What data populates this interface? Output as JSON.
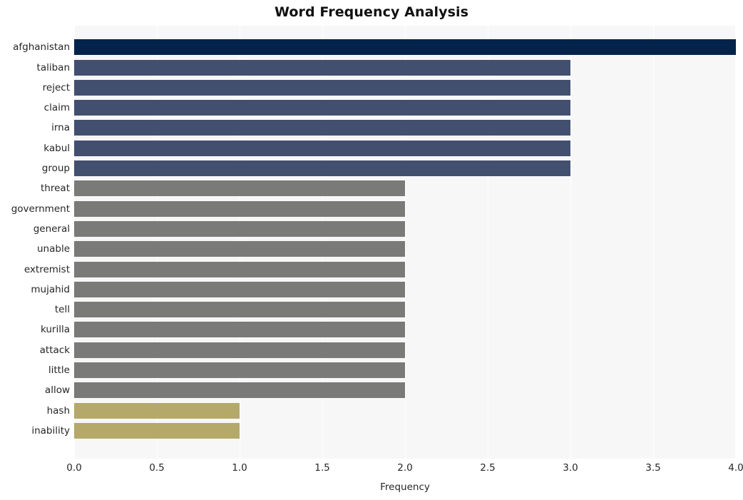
{
  "chart_data": {
    "type": "bar",
    "orientation": "horizontal",
    "title": "Word Frequency Analysis",
    "xlabel": "Frequency",
    "ylabel": "",
    "xlim": [
      0,
      4
    ],
    "ylim": null,
    "grid": true,
    "legend": null,
    "xticks": [
      "0.0",
      "0.5",
      "1.0",
      "1.5",
      "2.0",
      "2.5",
      "3.0",
      "3.5",
      "4.0"
    ],
    "xtick_values": [
      0,
      0.5,
      1,
      1.5,
      2,
      2.5,
      3,
      3.5,
      4
    ],
    "categories": [
      "afghanistan",
      "taliban",
      "reject",
      "claim",
      "irna",
      "kabul",
      "group",
      "threat",
      "government",
      "general",
      "unable",
      "extremist",
      "mujahid",
      "tell",
      "kurilla",
      "attack",
      "little",
      "allow",
      "hash",
      "inability"
    ],
    "values": [
      4,
      3,
      3,
      3,
      3,
      3,
      3,
      2,
      2,
      2,
      2,
      2,
      2,
      2,
      2,
      2,
      2,
      2,
      1,
      1
    ],
    "bar_colors": [
      "#03234b",
      "#424f6f",
      "#424f6f",
      "#424f6f",
      "#424f6f",
      "#424f6f",
      "#424f6f",
      "#7a7a78",
      "#7a7a78",
      "#7a7a78",
      "#7a7a78",
      "#7a7a78",
      "#7a7a78",
      "#7a7a78",
      "#7a7a78",
      "#7a7a78",
      "#7a7a78",
      "#7a7a78",
      "#b5a96a",
      "#b5a96a"
    ]
  },
  "style": {
    "plot_background": "#f7f7f8",
    "gridline_color": "#ffffff",
    "text_color": "#262626",
    "title_color": "#111111"
  }
}
